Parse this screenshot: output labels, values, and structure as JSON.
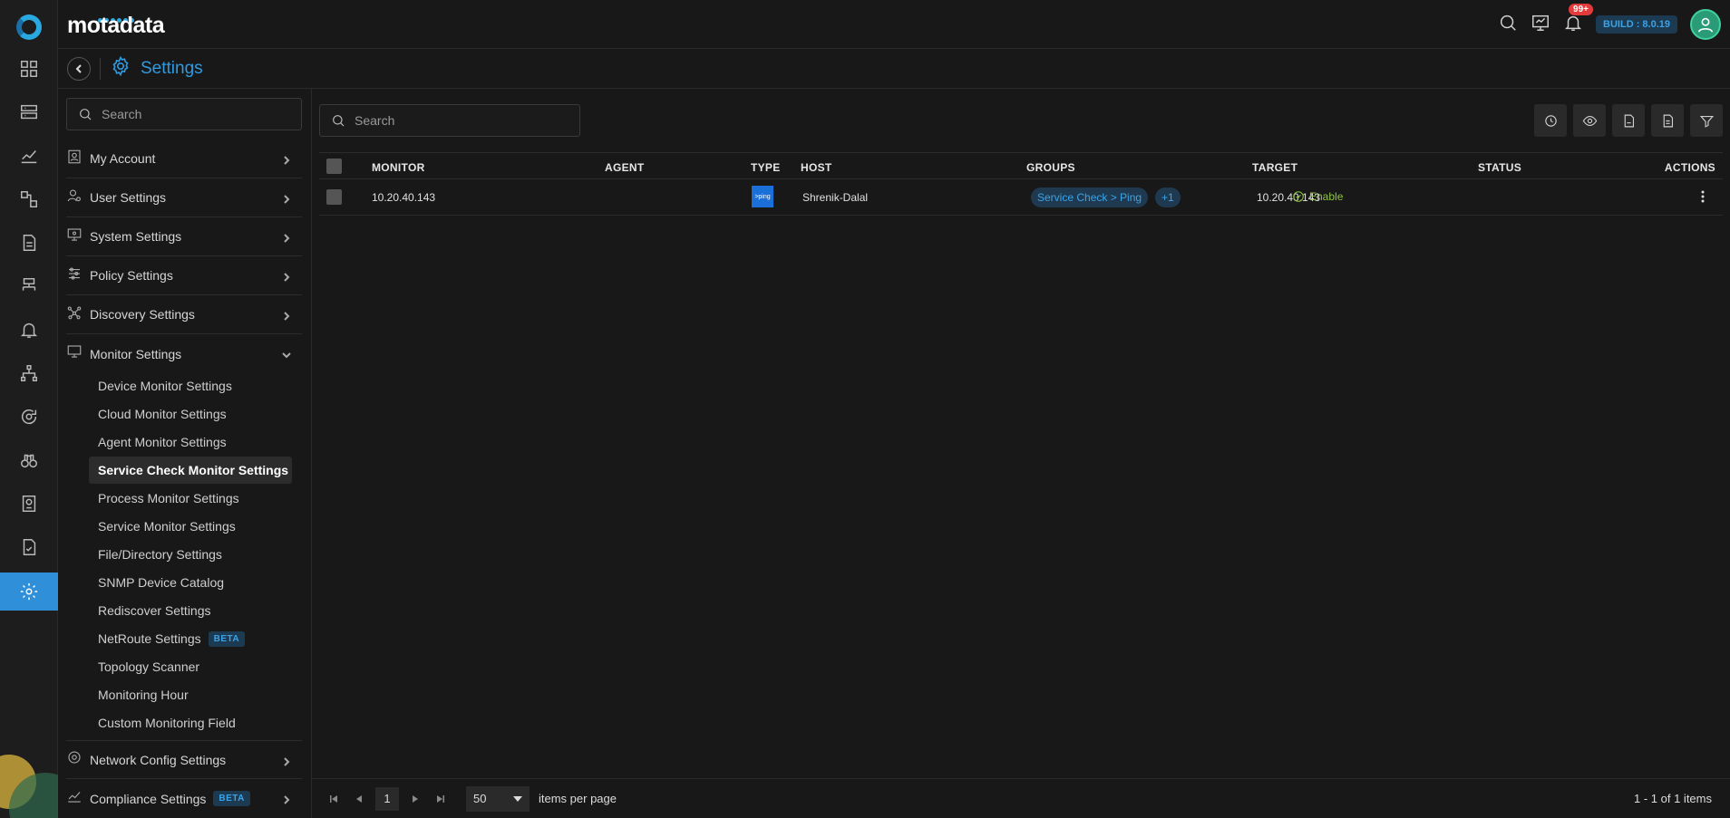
{
  "brand": {
    "name": "motadata"
  },
  "topbar": {
    "notifications_badge": "99+",
    "build": "BUILD : 8.0.19"
  },
  "page": {
    "title": "Settings"
  },
  "menu": {
    "search_placeholder": "Search",
    "groups": [
      {
        "label": "My Account"
      },
      {
        "label": "User Settings"
      },
      {
        "label": "System Settings"
      },
      {
        "label": "Policy Settings"
      },
      {
        "label": "Discovery Settings"
      },
      {
        "label": "Monitor Settings"
      },
      {
        "label": "Network Config Settings"
      },
      {
        "label": "Compliance Settings",
        "badge": "BETA"
      }
    ],
    "monitor_items": [
      {
        "label": "Device Monitor Settings"
      },
      {
        "label": "Cloud Monitor Settings"
      },
      {
        "label": "Agent Monitor Settings"
      },
      {
        "label": "Service Check Monitor Settings",
        "active": true
      },
      {
        "label": "Process Monitor Settings"
      },
      {
        "label": "Service Monitor Settings"
      },
      {
        "label": "File/Directory Settings"
      },
      {
        "label": "SNMP Device Catalog"
      },
      {
        "label": "Rediscover Settings"
      },
      {
        "label": "NetRoute Settings",
        "badge": "BETA"
      },
      {
        "label": "Topology Scanner"
      },
      {
        "label": "Monitoring Hour"
      },
      {
        "label": "Custom Monitoring Field"
      }
    ]
  },
  "main": {
    "search_placeholder": "Search",
    "columns": [
      "MONITOR",
      "AGENT",
      "TYPE",
      "HOST",
      "GROUPS",
      "TARGET",
      "STATUS",
      "ACTIONS"
    ],
    "rows": [
      {
        "monitor": "10.20.40.143",
        "agent": "",
        "type_label": ">ping",
        "host": "Shrenik-Dalal",
        "group": "Service Check > Ping",
        "group_more": "+1",
        "target": "10.20.40.143",
        "status": "Enable"
      }
    ],
    "pager": {
      "page": "1",
      "page_size": "50",
      "items_per_page_label": "items per page",
      "info": "1 - 1 of 1 items"
    }
  }
}
